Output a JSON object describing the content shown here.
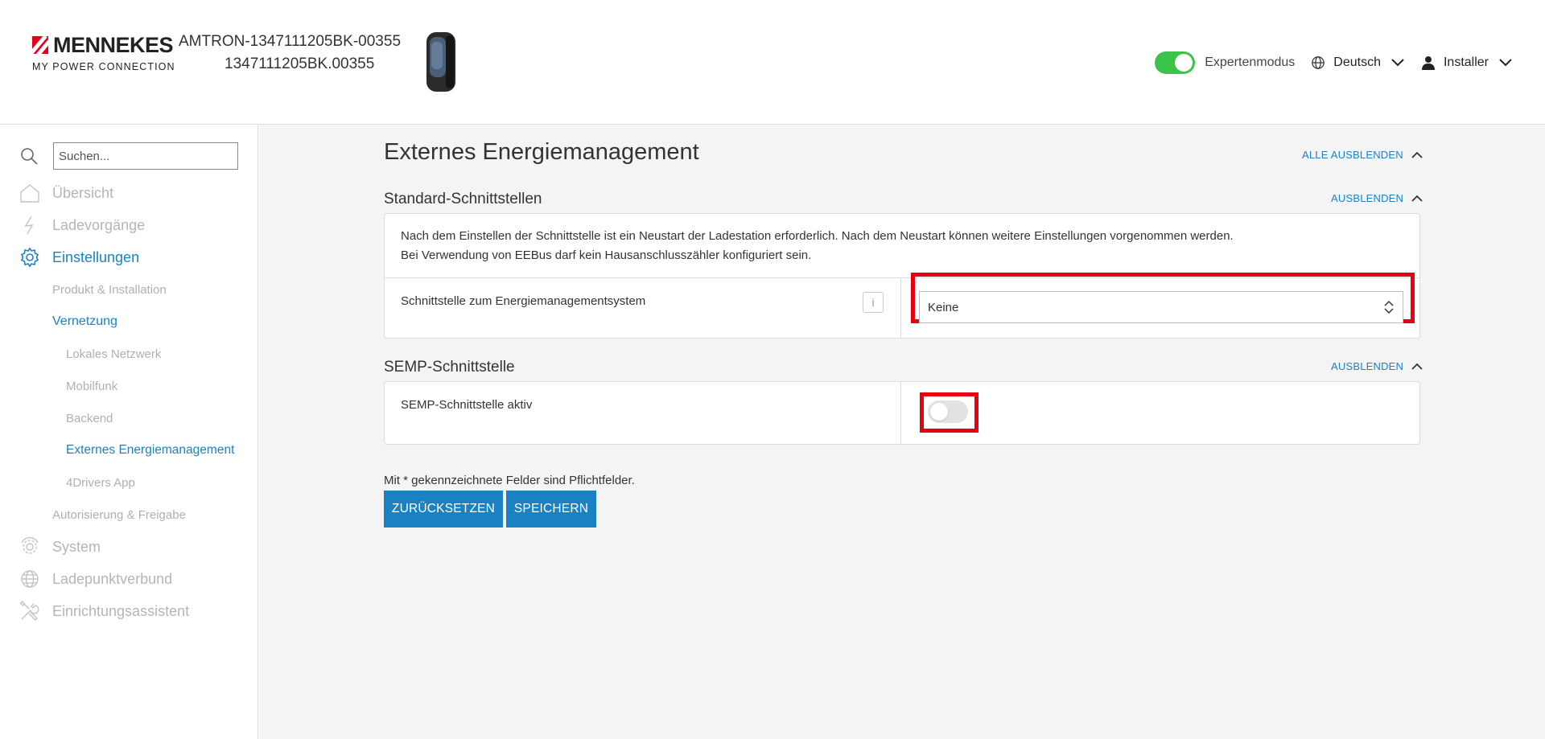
{
  "header": {
    "logo_word": "MENNEKES",
    "logo_tagline": "MY  POWER  CONNECTION",
    "device_name": "AMTRON-1347111205BK-00355",
    "device_serial": "1347111205BK.00355",
    "expert_mode_label": "Expertenmodus",
    "expert_mode_on": true,
    "language_label": "Deutsch",
    "user_label": "Installer"
  },
  "sidebar": {
    "search_placeholder": "Suchen...",
    "items": [
      {
        "label": "Übersicht",
        "icon": "home-icon"
      },
      {
        "label": "Ladevorgänge",
        "icon": "lightning-icon"
      },
      {
        "label": "Einstellungen",
        "icon": "gear-icon"
      },
      {
        "label": "Produkt & Installation"
      },
      {
        "label": "Vernetzung"
      },
      {
        "label": "Lokales Netzwerk"
      },
      {
        "label": "Mobilfunk"
      },
      {
        "label": "Backend"
      },
      {
        "label": "Externes Energiemanagement"
      },
      {
        "label": "4Drivers App"
      },
      {
        "label": "Autorisierung & Freigabe"
      },
      {
        "label": "System",
        "icon": "system-icon"
      },
      {
        "label": "Ladepunktverbund",
        "icon": "globe-icon"
      },
      {
        "label": "Einrichtungsassistent",
        "icon": "tools-icon"
      }
    ]
  },
  "main": {
    "title": "Externes Energiemanagement",
    "collapse_all": "ALLE AUSBLENDEN",
    "sections": [
      {
        "title": "Standard-Schnittstellen",
        "collapse": "AUSBLENDEN",
        "note_line1": "Nach dem Einstellen der Schnittstelle ist ein Neustart der Ladestation erforderlich. Nach dem Neustart können weitere Einstellungen vorgenommen werden.",
        "note_line2": "Bei Verwendung von EEBus darf kein Hausanschlusszähler konfiguriert sein.",
        "row_label": "Schnittstelle zum Energiemanagementsystem",
        "info": "i",
        "select_value": "Keine"
      },
      {
        "title": "SEMP-Schnittstelle",
        "collapse": "AUSBLENDEN",
        "row_label": "SEMP-Schnittstelle aktiv",
        "toggle_on": false
      }
    ],
    "required_note": "Mit * gekennzeichnete Felder sind Pflichtfelder.",
    "reset_button": "ZURÜCKSETZEN",
    "save_button": "SPEICHERN"
  },
  "colors": {
    "accent": "#1a82c3",
    "toggle_on": "#3bc34a",
    "highlight": "#e8000f",
    "brand_red": "#e2001a"
  }
}
